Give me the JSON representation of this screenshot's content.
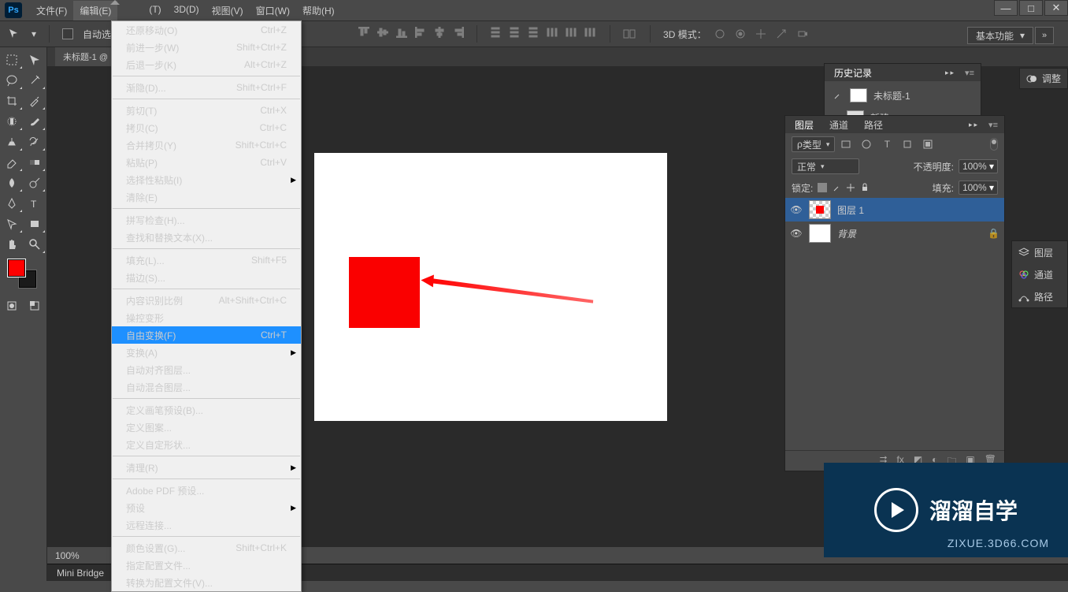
{
  "title": {
    "app": "Ps"
  },
  "menubar": [
    "文件(F)",
    "编辑(E)",
    "",
    "",
    "(T)",
    "3D(D)",
    "视图(V)",
    "窗口(W)",
    "帮助(H)"
  ],
  "optionsbar": {
    "auto_select": "自动选择：",
    "mode_3d": "3D 模式："
  },
  "workspace_label": "基本功能",
  "doc_tab": "未标题-1 @",
  "dropdown_groups": [
    [
      {
        "label": "还原移动(O)",
        "shortcut": "Ctrl+Z"
      },
      {
        "label": "前进一步(W)",
        "shortcut": "Shift+Ctrl+Z"
      },
      {
        "label": "后退一步(K)",
        "shortcut": "Alt+Ctrl+Z"
      }
    ],
    [
      {
        "label": "渐隐(D)...",
        "shortcut": "Shift+Ctrl+F",
        "disabled": true
      }
    ],
    [
      {
        "label": "剪切(T)",
        "shortcut": "Ctrl+X"
      },
      {
        "label": "拷贝(C)",
        "shortcut": "Ctrl+C"
      },
      {
        "label": "合并拷贝(Y)",
        "shortcut": "Shift+Ctrl+C"
      },
      {
        "label": "粘贴(P)",
        "shortcut": "Ctrl+V"
      },
      {
        "label": "选择性粘贴(I)",
        "submenu": true
      },
      {
        "label": "清除(E)",
        "disabled": true
      }
    ],
    [
      {
        "label": "拼写检查(H)...",
        "disabled": true
      },
      {
        "label": "查找和替换文本(X)...",
        "disabled": true
      }
    ],
    [
      {
        "label": "填充(L)...",
        "shortcut": "Shift+F5"
      },
      {
        "label": "描边(S)...",
        "disabled": true
      }
    ],
    [
      {
        "label": "内容识别比例",
        "shortcut": "Alt+Shift+Ctrl+C"
      },
      {
        "label": "操控变形"
      },
      {
        "label": "自由变换(F)",
        "shortcut": "Ctrl+T",
        "highlighted": true
      },
      {
        "label": "变换(A)",
        "submenu": true
      },
      {
        "label": "自动对齐图层...",
        "disabled": true
      },
      {
        "label": "自动混合图层...",
        "disabled": true
      }
    ],
    [
      {
        "label": "定义画笔预设(B)..."
      },
      {
        "label": "定义图案..."
      },
      {
        "label": "定义自定形状...",
        "disabled": true
      }
    ],
    [
      {
        "label": "清理(R)",
        "submenu": true
      }
    ],
    [
      {
        "label": "Adobe PDF 预设..."
      },
      {
        "label": "预设",
        "submenu": true
      },
      {
        "label": "远程连接..."
      }
    ],
    [
      {
        "label": "颜色设置(G)...",
        "shortcut": "Shift+Ctrl+K"
      },
      {
        "label": "指定配置文件..."
      },
      {
        "label": "转换为配置文件(V)..."
      }
    ]
  ],
  "history": {
    "title": "历史记录",
    "doc": "未标题-1",
    "step": "新建"
  },
  "adjustments_label": "调整",
  "layers_panel": {
    "tabs": [
      "图层",
      "通道",
      "路径"
    ],
    "kind_filter": "类型",
    "blend_mode": "正常",
    "opacity_label": "不透明度:",
    "opacity_val": "100%",
    "lock_label": "锁定:",
    "fill_label": "填充:",
    "fill_val": "100%",
    "layers": [
      {
        "name": "图层 1",
        "selected": true,
        "thumb": "checker-red"
      },
      {
        "name": "背景",
        "locked": true,
        "thumb": "white",
        "italic": true
      }
    ]
  },
  "collapsed_panels": [
    "图层",
    "通道",
    "路径"
  ],
  "statusbar": {
    "zoom": "100%",
    "minibridge": "Mini Bridge"
  },
  "watermark": {
    "brand": "溜溜自学",
    "url": "ZIXUE.3D66.COM"
  }
}
